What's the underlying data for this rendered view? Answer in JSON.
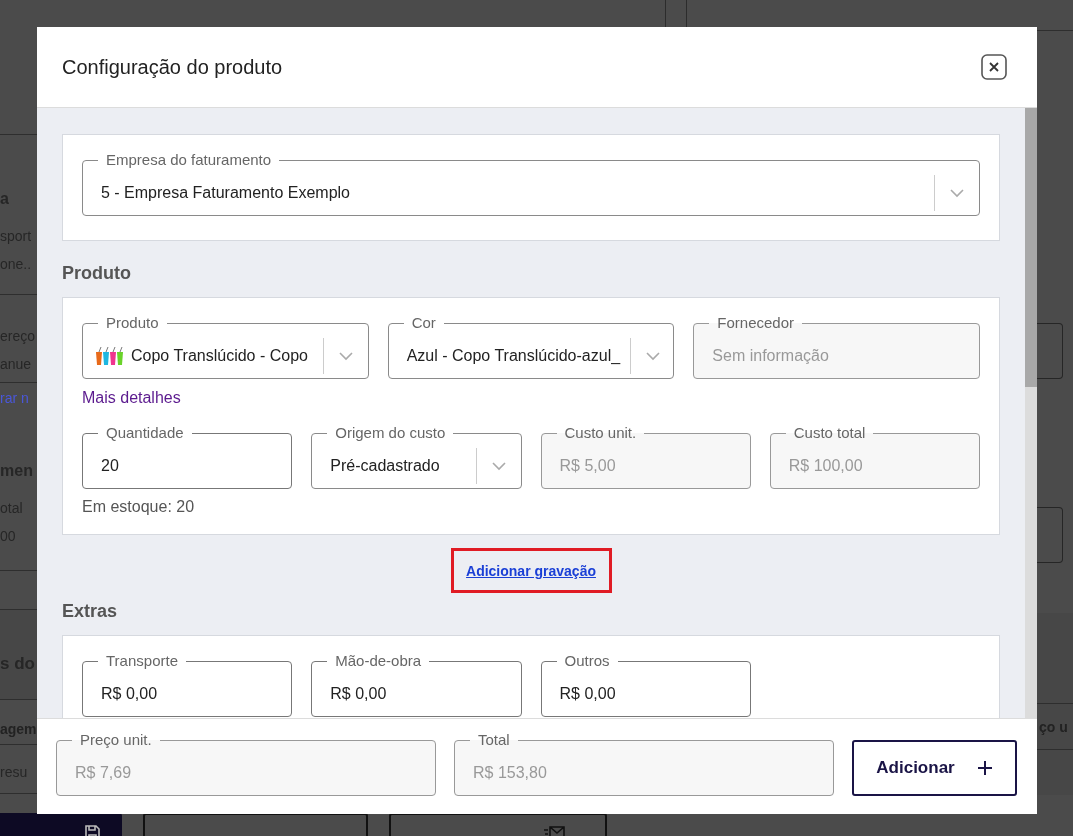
{
  "background": {
    "left_sections": [
      [
        {
          "kind": "heading",
          "text": "a"
        },
        {
          "kind": "text",
          "text": "sport"
        },
        {
          "kind": "text",
          "text": "one.."
        }
      ],
      [
        {
          "kind": "text",
          "text": "ereço"
        },
        {
          "kind": "text",
          "text": "anue"
        }
      ],
      [
        {
          "kind": "link",
          "text": "rar n"
        },
        {
          "kind": "heading",
          "text": "men"
        },
        {
          "kind": "text",
          "text": "otal"
        },
        {
          "kind": "text",
          "text": "00"
        }
      ],
      [
        {
          "kind": "title",
          "text": "s do"
        }
      ],
      [
        {
          "kind": "strong",
          "text": "agem"
        }
      ],
      [
        {
          "kind": "text",
          "text": "resu"
        }
      ]
    ],
    "right_text": "ço u",
    "bottom_buttons": [
      {
        "kind": "primary"
      },
      {
        "kind": "outline"
      },
      {
        "kind": "outline"
      }
    ]
  },
  "modal": {
    "title": "Configuração do produto",
    "billing_company": {
      "kind": "select",
      "label": "Empresa do faturamento",
      "value": "5 - Empresa Faturamento Exemplo"
    },
    "product": {
      "heading": "Produto",
      "main_fields": [
        {
          "kind": "image_select",
          "label": "Produto",
          "value": "Copo Translúcido - Copo"
        },
        {
          "kind": "select",
          "label": "Cor",
          "value": "Azul - Copo Translúcido-azul_"
        },
        {
          "kind": "readonly",
          "label": "Fornecedor",
          "placeholder": "Sem informação"
        }
      ],
      "details_link": "Mais detalhes",
      "cost_fields": [
        {
          "kind": "input",
          "label": "Quantidade",
          "value": "20"
        },
        {
          "kind": "select",
          "label": "Origem do custo",
          "value": "Pré-cadastrado"
        },
        {
          "kind": "readonly",
          "label": "Custo unit.",
          "value": "R$ 5,00"
        },
        {
          "kind": "readonly",
          "label": "Custo total",
          "value": "R$ 100,00"
        }
      ],
      "stock": "Em estoque: 20"
    },
    "engraving_link": "Adicionar gravação",
    "extras": {
      "heading": "Extras",
      "fields": [
        {
          "kind": "input",
          "label": "Transporte",
          "value": "R$ 0,00"
        },
        {
          "kind": "input",
          "label": "Mão-de-obra",
          "value": "R$ 0,00"
        },
        {
          "kind": "input",
          "label": "Outros",
          "value": "R$ 0,00"
        }
      ]
    },
    "footer": {
      "fields": [
        {
          "kind": "readonly",
          "label": "Preço unit.",
          "value": "R$ 7,69"
        },
        {
          "kind": "readonly",
          "label": "Total",
          "value": "R$ 153,80"
        }
      ],
      "add_button": "Adicionar"
    }
  }
}
